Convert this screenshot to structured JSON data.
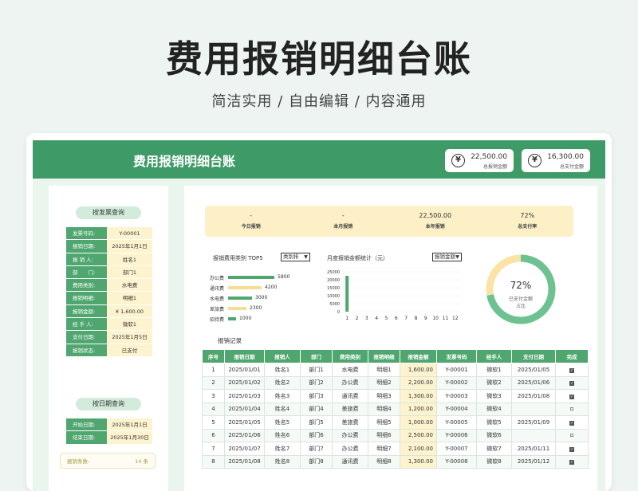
{
  "hero": {
    "title": "费用报销明细台账",
    "subtitle": "简洁实用 / 自由编辑 / 内容通用"
  },
  "topbar": {
    "title": "费用报销明细台账",
    "cards": [
      {
        "value": "22,500.00",
        "label": "总报销金额",
        "icon": "yen-icon"
      },
      {
        "value": "16,300.00",
        "label": "总支付金额",
        "icon": "yen-icon"
      }
    ]
  },
  "left": {
    "invoice_query": {
      "title": "按发票查询",
      "rows": [
        {
          "key": "发票号码:",
          "value": "Y-00001"
        },
        {
          "key": "报销日期:",
          "value": "2025年1月1日"
        },
        {
          "key": "报 销 人:",
          "value": "姓名1"
        },
        {
          "key": "部　　门:",
          "value": "部门1"
        },
        {
          "key": "费用类别:",
          "value": "水电费"
        },
        {
          "key": "报销明细:",
          "value": "明细1"
        },
        {
          "key": "报销金额:",
          "value": "¥ 1,600.00"
        },
        {
          "key": "经 手 人:",
          "value": "微软1"
        },
        {
          "key": "支付日期:",
          "value": "2025年1月5日"
        },
        {
          "key": "报销状态:",
          "value": "已支付"
        }
      ]
    },
    "date_query": {
      "title": "按日期查询",
      "rows": [
        {
          "key": "开始日期:",
          "value": "2025年1月1日"
        },
        {
          "key": "结束日期:",
          "value": "2025年1月30日"
        }
      ]
    },
    "bottom": {
      "label": "报销条数:",
      "value": "14 条"
    }
  },
  "summary": [
    {
      "value": "-",
      "label": "今日报销"
    },
    {
      "value": "-",
      "label": "本月报销"
    },
    {
      "value": "22,500.00",
      "label": "本年报销"
    },
    {
      "value": "72%",
      "label": "总支付率"
    }
  ],
  "category": {
    "title": "报销费用类别 TOP5",
    "sort_label": "类别排",
    "items": [
      {
        "name": "办公费",
        "value": 5800,
        "color": "#4fa66f"
      },
      {
        "name": "通讯费",
        "value": 4200,
        "color": "#f7dc94"
      },
      {
        "name": "水电费",
        "value": 3000,
        "color": "#4fa66f"
      },
      {
        "name": "差旅费",
        "value": 2300,
        "color": "#f7dc94"
      },
      {
        "name": "招待费",
        "value": 1000,
        "color": "#4fa66f"
      }
    ]
  },
  "monthly": {
    "title": "月度报销金额统计（元）",
    "select_label": "报销金额",
    "y_ticks": [
      "25000",
      "20000",
      "15000",
      "10000",
      "5000",
      "0"
    ],
    "x_ticks": [
      "1",
      "2",
      "3",
      "4",
      "5",
      "6",
      "7",
      "8",
      "9",
      "10",
      "11",
      "12"
    ]
  },
  "chart_data": {
    "type": "bar",
    "categories": [
      "1",
      "2",
      "3",
      "4",
      "5",
      "6",
      "7",
      "8",
      "9",
      "10",
      "11",
      "12"
    ],
    "values": [
      22500,
      0,
      0,
      0,
      0,
      0,
      0,
      0,
      0,
      0,
      0,
      0
    ],
    "title": "月度报销金额统计（元）",
    "ylim": [
      0,
      25000
    ]
  },
  "donut": {
    "percent": 72,
    "percent_label": "72%",
    "label_line1": "已支付金额",
    "label_line2": "占比",
    "color_paid": "#6cc290",
    "color_rest": "#fbe3a6"
  },
  "records": {
    "title": "报销记录",
    "columns": [
      "序号",
      "报销日期",
      "报销人",
      "部门",
      "费用类别",
      "报销明细",
      "报销金额",
      "发票号码",
      "经手人",
      "支付日期",
      "完成"
    ],
    "rows": [
      [
        "1",
        "2025/01/01",
        "姓名1",
        "部门1",
        "水电费",
        "明细1",
        "1,600.00",
        "Y-00001",
        "微软1",
        "2025/01/05",
        "on"
      ],
      [
        "2",
        "2025/01/02",
        "姓名2",
        "部门2",
        "办公费",
        "明细2",
        "2,200.00",
        "Y-00002",
        "微软2",
        "2025/01/06",
        "on"
      ],
      [
        "3",
        "2025/01/03",
        "姓名3",
        "部门3",
        "通讯费",
        "明细3",
        "1,300.00",
        "Y-00003",
        "微软3",
        "2025/01/08",
        "on"
      ],
      [
        "4",
        "2025/01/04",
        "姓名4",
        "部门4",
        "差旅费",
        "明细4",
        "1,200.00",
        "Y-00004",
        "微软4",
        "",
        "off"
      ],
      [
        "5",
        "2025/01/05",
        "姓名5",
        "部门5",
        "差旅费",
        "明细5",
        "1,000.00",
        "Y-00005",
        "微软5",
        "2025/01/09",
        "on"
      ],
      [
        "6",
        "2025/01/06",
        "姓名6",
        "部门6",
        "办公费",
        "明细6",
        "2,500.00",
        "Y-00006",
        "微软6",
        "",
        "off"
      ],
      [
        "7",
        "2025/01/07",
        "姓名7",
        "部门7",
        "办公费",
        "明细7",
        "2,100.00",
        "Y-00007",
        "微软7",
        "2025/01/11",
        "on"
      ],
      [
        "8",
        "2025/01/08",
        "姓名8",
        "部门8",
        "通讯费",
        "明细8",
        "1,300.00",
        "Y-00008",
        "微软8",
        "2025/01/12",
        "on"
      ]
    ]
  }
}
